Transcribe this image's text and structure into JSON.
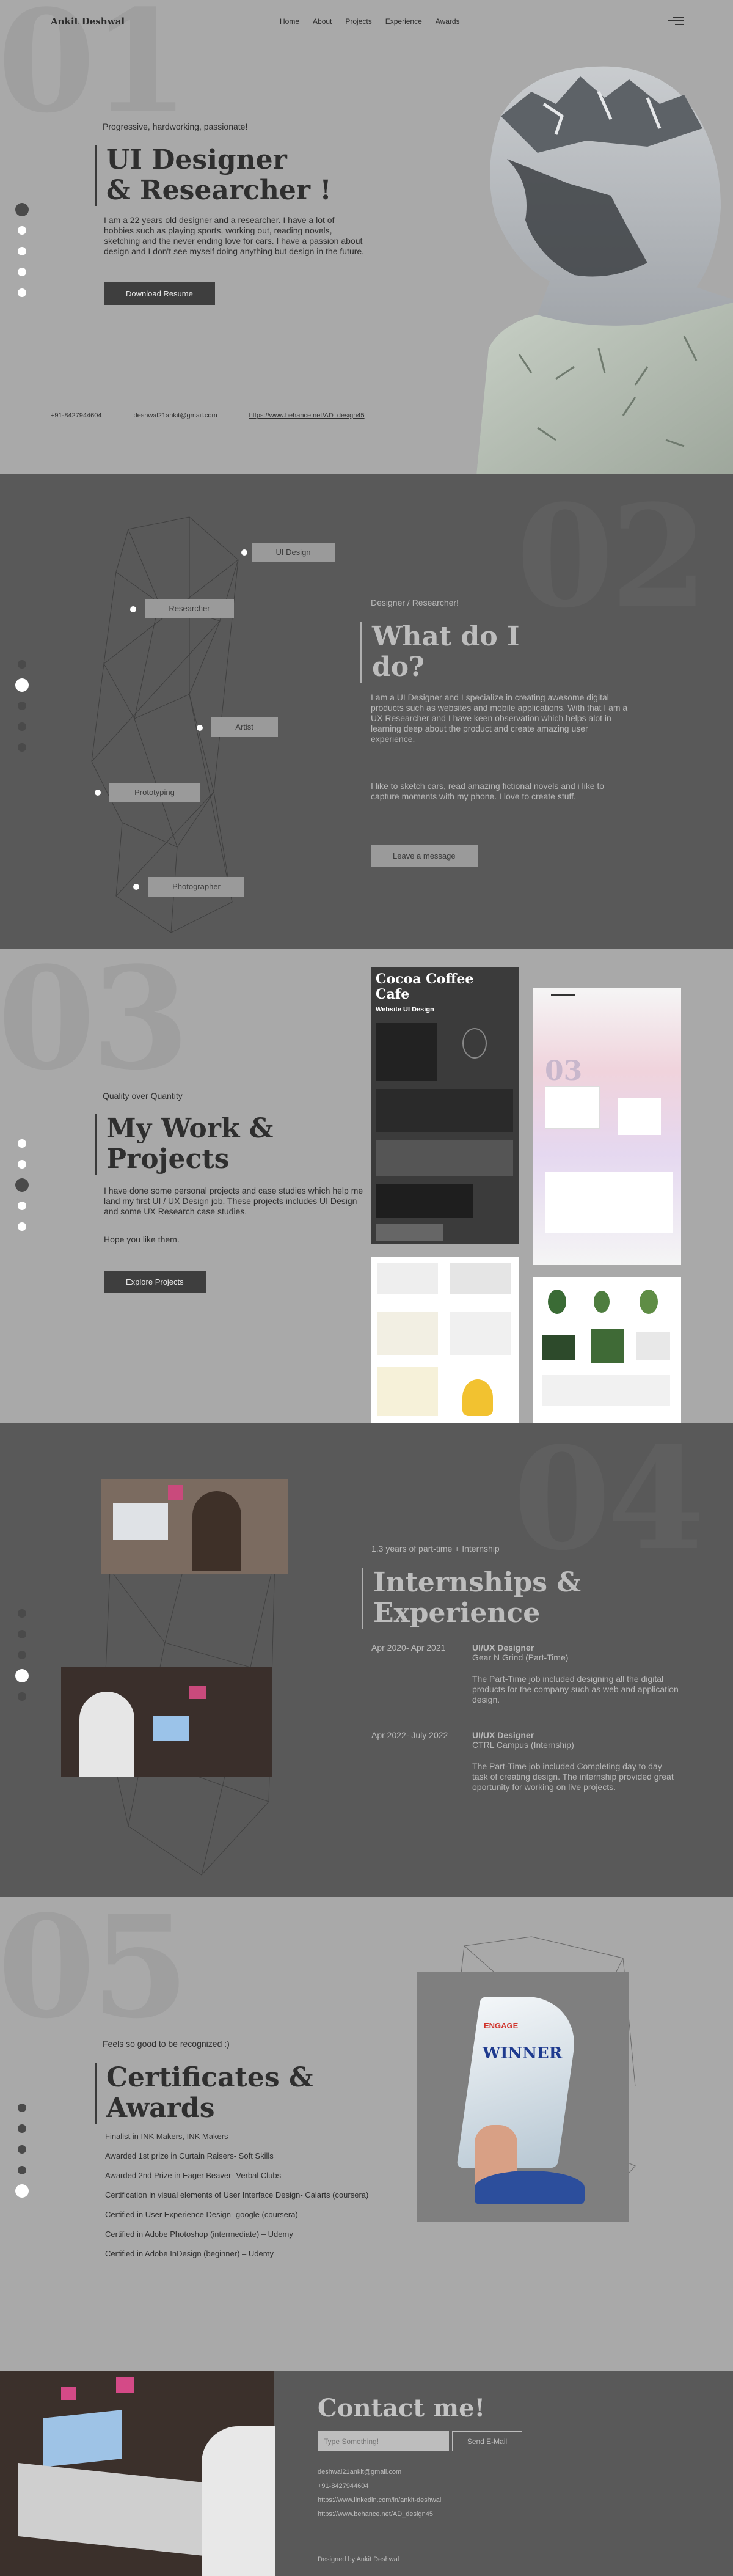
{
  "header": {
    "brand": "Ankit Deshwal",
    "nav": [
      "Home",
      "About",
      "Projects",
      "Experience",
      "Awards"
    ]
  },
  "hero": {
    "number": "01",
    "tagline": "Progressive, hardworking, passionate!",
    "title_line1": "UI Designer",
    "title_line2": "& Researcher !",
    "description": "I am a 22 years old designer and a researcher. I have a lot of hobbies such as playing sports, working out, reading novels, sketching and the never ending love for cars. I have a passion about design and I don't see myself doing anything but design in the future.",
    "button": "Download Resume",
    "phone": "+91-8427944604",
    "email": "deshwal21ankit@gmail.com",
    "behance": "https://www.behance.net/AD_design45"
  },
  "about": {
    "number": "02",
    "tags": [
      "UI Design",
      "Researcher",
      "Artist",
      "Prototyping",
      "Photographer"
    ],
    "eyebrow": "Designer / Researcher!",
    "title_line1": "What do I",
    "title_line2": "do?",
    "p1": "I am a UI Designer and I specialize in creating awesome digital products such as websites and mobile applications. With that I am a UX Researcher and I have keen observation which helps alot in learning deep about the product and create amazing user experience.",
    "p2": "I like to sketch cars, read amazing fictional novels and i like to capture moments with my phone. I love to create stuff.",
    "button": "Leave a message"
  },
  "work": {
    "number": "03",
    "eyebrow": "Quality over Quantity",
    "title_line1": "My Work &",
    "title_line2": "Projects",
    "p1": "I have done some personal projects and case studies which help me land my first UI / UX Design job. These projects includes UI Design and some UX Research case studies.",
    "p2": "Hope you like them.",
    "button": "Explore Projects",
    "card1_title": "Cocoa Coffee Cafe",
    "card1_sub": "Website UI Design"
  },
  "experience": {
    "number": "04",
    "eyebrow": "1.3 years of part-time + Internship",
    "title_line1": "Internships &",
    "title_line2": "Experience",
    "items": [
      {
        "period": "Apr 2020- Apr 2021",
        "role": "UI/UX Designer",
        "company": "Gear N Grind (Part-Time)",
        "desc": "The Part-Time job included designing all the digital products for the company such as web and application design."
      },
      {
        "period": "Apr 2022- July 2022",
        "role": "UI/UX Designer",
        "company": "CTRL Campus (Internship)",
        "desc": "The Part-Time job included Completing day to day task of creating design. The internship provided great oportunity for working on live projects."
      }
    ]
  },
  "awards": {
    "number": "05",
    "eyebrow": "Feels so good to be recognized :)",
    "title_line1": "Certificates &",
    "title_line2": "Awards",
    "items": [
      "Finalist in INK Makers, INK Makers",
      "Awarded 1st prize in Curtain Raisers- Soft Skills",
      "Awarded 2nd Prize in Eager Beaver- Verbal Clubs",
      "Certification in visual elements of User Interface Design- Calarts (coursera)",
      "Certified in User Experience Design- google (coursera)",
      "Certified in Adobe Photoshop (intermediate) – Udemy",
      "Certified in Adobe InDesign (beginner) – Udemy"
    ],
    "trophy_brand": "ENGAGE",
    "trophy_winner": "WINNER"
  },
  "contact": {
    "title": "Contact me!",
    "placeholder": "Type Something!",
    "button": "Send E-Mail",
    "email": "deshwal21ankit@gmail.com",
    "phone": "+91-8427944604",
    "linkedin": "https://www.linkedin.com/in/ankit-deshwal",
    "behance": "https://www.behance.net/AD_design45",
    "footer": "Designed by Ankit Deshwal"
  }
}
